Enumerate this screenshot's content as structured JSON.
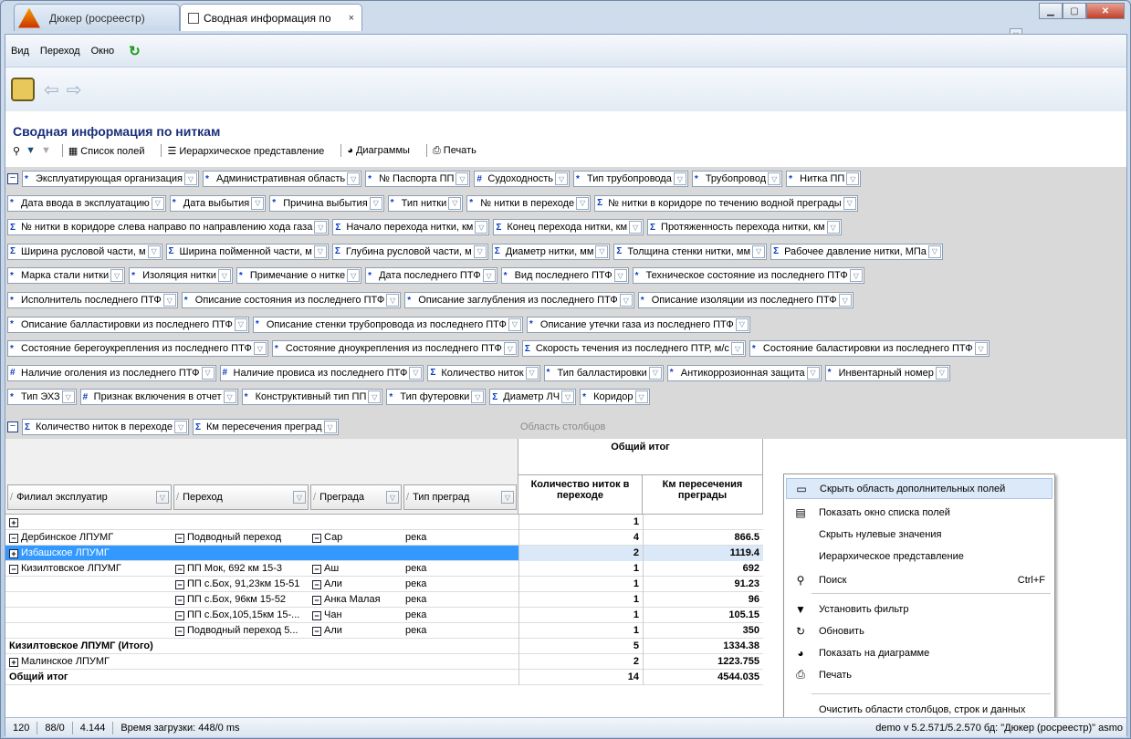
{
  "window": {
    "tab1": "Дюкер (росреестр)",
    "tab2": "Сводная информация по",
    "tab_close": "×"
  },
  "menu": [
    "Вид",
    "Переход",
    "Окно"
  ],
  "header": {
    "title": "Сводная информация по ниткам",
    "toolbar": [
      "Список полей",
      "Иерархическое представление",
      "Диаграммы",
      "Печать"
    ]
  },
  "filter_rows": [
    [
      [
        "*",
        "Эксплуатирующая организация"
      ],
      [
        "*",
        "Административная область"
      ],
      [
        "*",
        "№ Паспорта ПП"
      ],
      [
        "#",
        "Судоходность"
      ],
      [
        "*",
        "Тип трубопровода"
      ],
      [
        "*",
        "Трубопровод"
      ],
      [
        "*",
        "Нитка ПП"
      ]
    ],
    [
      [
        "*",
        "Дата ввода в эксплуатацию"
      ],
      [
        "*",
        "Дата выбытия"
      ],
      [
        "*",
        "Причина выбытия"
      ],
      [
        "*",
        "Тип нитки"
      ],
      [
        "*",
        "№ нитки в переходе"
      ],
      [
        "Σ",
        "№ нитки в коридоре по течению водной преграды"
      ]
    ],
    [
      [
        "Σ",
        "№ нитки в коридоре слева направо по направлению хода газа"
      ],
      [
        "Σ",
        "Начало перехода нитки, км"
      ],
      [
        "Σ",
        "Конец перехода нитки, км"
      ],
      [
        "Σ",
        "Протяженность перехода нитки, км"
      ]
    ],
    [
      [
        "Σ",
        "Ширина русловой части, м"
      ],
      [
        "Σ",
        "Ширина пойменной части, м"
      ],
      [
        "Σ",
        "Глубина русловой части, м"
      ],
      [
        "Σ",
        "Диаметр нитки, мм"
      ],
      [
        "Σ",
        "Толщина стенки нитки, мм"
      ],
      [
        "Σ",
        "Рабочее давление нитки, МПа"
      ]
    ],
    [
      [
        "*",
        "Марка стали нитки"
      ],
      [
        "*",
        "Изоляция нитки"
      ],
      [
        "*",
        "Примечание о нитке"
      ],
      [
        "*",
        "Дата последнего ПТФ"
      ],
      [
        "*",
        "Вид последнего ПТФ"
      ],
      [
        "*",
        "Техническое состояние из последнего ПТФ"
      ]
    ],
    [
      [
        "*",
        "Исполнитель последнего ПТФ"
      ],
      [
        "*",
        "Описание состояния из последнего ПТФ"
      ],
      [
        "*",
        "Описание заглубления из последнего ПТФ"
      ],
      [
        "*",
        "Описание изоляции из последнего ПТФ"
      ]
    ],
    [
      [
        "*",
        "Описание балластировки из последнего ПТФ"
      ],
      [
        "*",
        "Описание стенки трубопровода из последнего ПТФ"
      ],
      [
        "*",
        "Описание утечки газа из последнего ПТФ"
      ]
    ],
    [
      [
        "*",
        "Состояние берегоукрепления из последнего ПТФ"
      ],
      [
        "*",
        "Состояние дноукрепления из последнего ПТФ"
      ],
      [
        "Σ",
        "Скорость течения из последнего ПТР, м/с"
      ],
      [
        "*",
        "Состояние баластировки из последнего ПТФ"
      ]
    ],
    [
      [
        "#",
        "Наличие оголения из последнего ПТФ"
      ],
      [
        "#",
        "Наличие провиса из последнего ПТФ"
      ],
      [
        "Σ",
        "Количество ниток"
      ],
      [
        "*",
        "Тип балластировки"
      ],
      [
        "*",
        "Антикоррозионная защита"
      ],
      [
        "*",
        "Инвентарный номер"
      ]
    ],
    [
      [
        "*",
        "Тип ЭХЗ"
      ],
      [
        "#",
        "Признак включения в отчет"
      ],
      [
        "*",
        "Конструктивный тип ПП"
      ],
      [
        "*",
        "Тип футеровки"
      ],
      [
        "Σ",
        "Диаметр ЛЧ"
      ],
      [
        "*",
        "Коридор"
      ]
    ]
  ],
  "data_fields": [
    [
      "Σ",
      "Количество ниток в переходе"
    ],
    [
      "Σ",
      "Км пересечения преград"
    ]
  ],
  "column_area": "Область столбцов",
  "grid": {
    "grand_total_header": "Общий итог",
    "value_headers": [
      "Количество ниток в переходе",
      "Км пересечения преграды"
    ],
    "row_headers": [
      "Филиал эксплуатир",
      "Переход",
      "Преграда",
      "Тип преград"
    ]
  },
  "chart_data": {
    "type": "table",
    "columns": [
      "Филиал эксплуатир",
      "Переход",
      "Преграда",
      "Тип преград",
      "Количество ниток в переходе",
      "Км пересечения преграды"
    ],
    "rows": [
      [
        "",
        "",
        "",
        "",
        "1",
        ""
      ],
      [
        "Дербинское ЛПУМГ",
        "Подводный переход",
        "Сар",
        "река",
        "4",
        "866.5"
      ],
      [
        "Избашское ЛПУМГ",
        "",
        "",
        "",
        "2",
        "1119.4"
      ],
      [
        "Кизилтовское ЛПУМГ",
        "ПП Мок, 692 км 15-3",
        "Аш",
        "река",
        "1",
        "692"
      ],
      [
        "",
        "ПП с.Бох, 91,23км 15-51",
        "Али",
        "река",
        "1",
        "91.23"
      ],
      [
        "",
        "ПП с.Бох, 96км 15-52",
        "Анка Малая",
        "река",
        "1",
        "96"
      ],
      [
        "",
        "ПП с.Бох,105,15км 15-...",
        "Чан",
        "река",
        "1",
        "105.15"
      ],
      [
        "",
        "Подводный переход 5...",
        "Али",
        "река",
        "1",
        "350"
      ],
      [
        "Кизилтовское ЛПУМГ (Итого)",
        "",
        "",
        "",
        "5",
        "1334.38"
      ],
      [
        "Малинское ЛПУМГ",
        "",
        "",
        "",
        "2",
        "1223.755"
      ],
      [
        "Общий итог",
        "",
        "",
        "",
        "14",
        "4544.035"
      ]
    ]
  },
  "context_menu": [
    {
      "label": "Скрыть область дополнительных полей",
      "icon": "panel-icon",
      "glyph": "▭"
    },
    {
      "label": "Показать окно списка полей",
      "icon": "fieldlist-icon",
      "glyph": "▤"
    },
    {
      "label": "Скрыть нулевые значения",
      "icon": "",
      "glyph": ""
    },
    {
      "label": "Иерархическое представление",
      "icon": "",
      "glyph": ""
    },
    {
      "label": "Поиск",
      "icon": "binoculars-icon",
      "glyph": "⚲",
      "shortcut": "Ctrl+F"
    },
    {
      "label": "Установить фильтр",
      "icon": "filter-icon",
      "glyph": "▼"
    },
    {
      "label": "Обновить",
      "icon": "refresh-icon",
      "glyph": "↻"
    },
    {
      "label": "Показать на диаграмме",
      "icon": "pie-chart-icon",
      "glyph": "◕"
    },
    {
      "label": "Печать",
      "icon": "printer-icon",
      "glyph": "⎙"
    },
    {
      "label": "Очистить области столбцов, строк и данных",
      "icon": "",
      "glyph": ""
    }
  ],
  "status": {
    "s1": "120",
    "s2": "88/0",
    "s3": "4.144",
    "s4": "Время загрузки: 448/0 ms",
    "right": "demo  v 5.2.571/5.2.570  бд: \"Дюкер (росреестр)\" asmo"
  }
}
